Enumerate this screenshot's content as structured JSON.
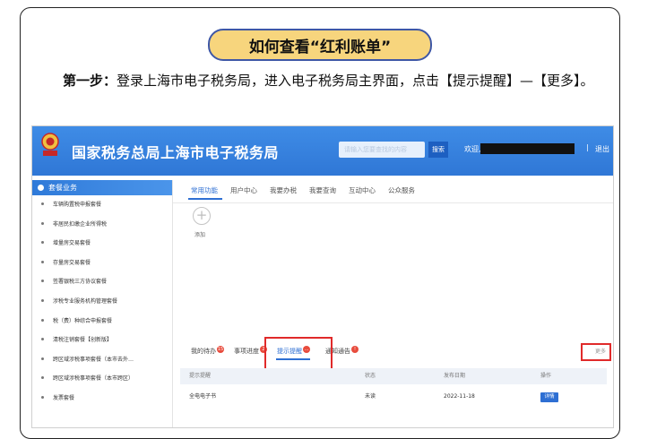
{
  "title": "如何查看“红利账单”",
  "instruction": {
    "step_label": "第一步：",
    "text": "登录上海市电子税务局，进入电子税务局主界面，点击【提示提醒】—【更多】。"
  },
  "screenshot": {
    "header": {
      "brand": "国家税务总局上海市电子税务局",
      "search_placeholder": "请输入您要查找的内容",
      "search_button": "搜索",
      "welcome": "欢迎,",
      "separator": "|",
      "logout": "退出"
    },
    "sidebar": {
      "heading": "套餐业务",
      "items": [
        "车辆购置税申报套餐",
        "非居民扣缴企业所得税",
        "增量房交易套餐",
        "存量房交易套餐",
        "签署银税三方协议套餐",
        "涉税专业服务机构管理套餐",
        "税（费）种综合申报套餐",
        "清税注销套餐【创新版】",
        "跨区域涉税事项套餐（本市去外…",
        "跨区域涉税事项套餐（本市跨区）",
        "发票套餐"
      ]
    },
    "main": {
      "tabs": [
        "常用功能",
        "用户中心",
        "我要办税",
        "我要查询",
        "互动中心",
        "公众服务"
      ],
      "active_tab": "常用功能",
      "add_label": "添加",
      "bottom_tabs": [
        {
          "label": "我的待办",
          "badge": "15"
        },
        {
          "label": "事项进度",
          "badge": "2"
        },
        {
          "label": "提示提醒",
          "badge": "..."
        },
        {
          "label": "通知通告",
          "badge": "!"
        }
      ],
      "more_label": "更多",
      "table": {
        "headers": [
          "提示提醒",
          "状态",
          "发布日期",
          "操作"
        ],
        "rows": [
          {
            "title": "全电电子书",
            "status": "未读",
            "date": "2022-11-18",
            "action": "详情"
          }
        ]
      }
    }
  }
}
